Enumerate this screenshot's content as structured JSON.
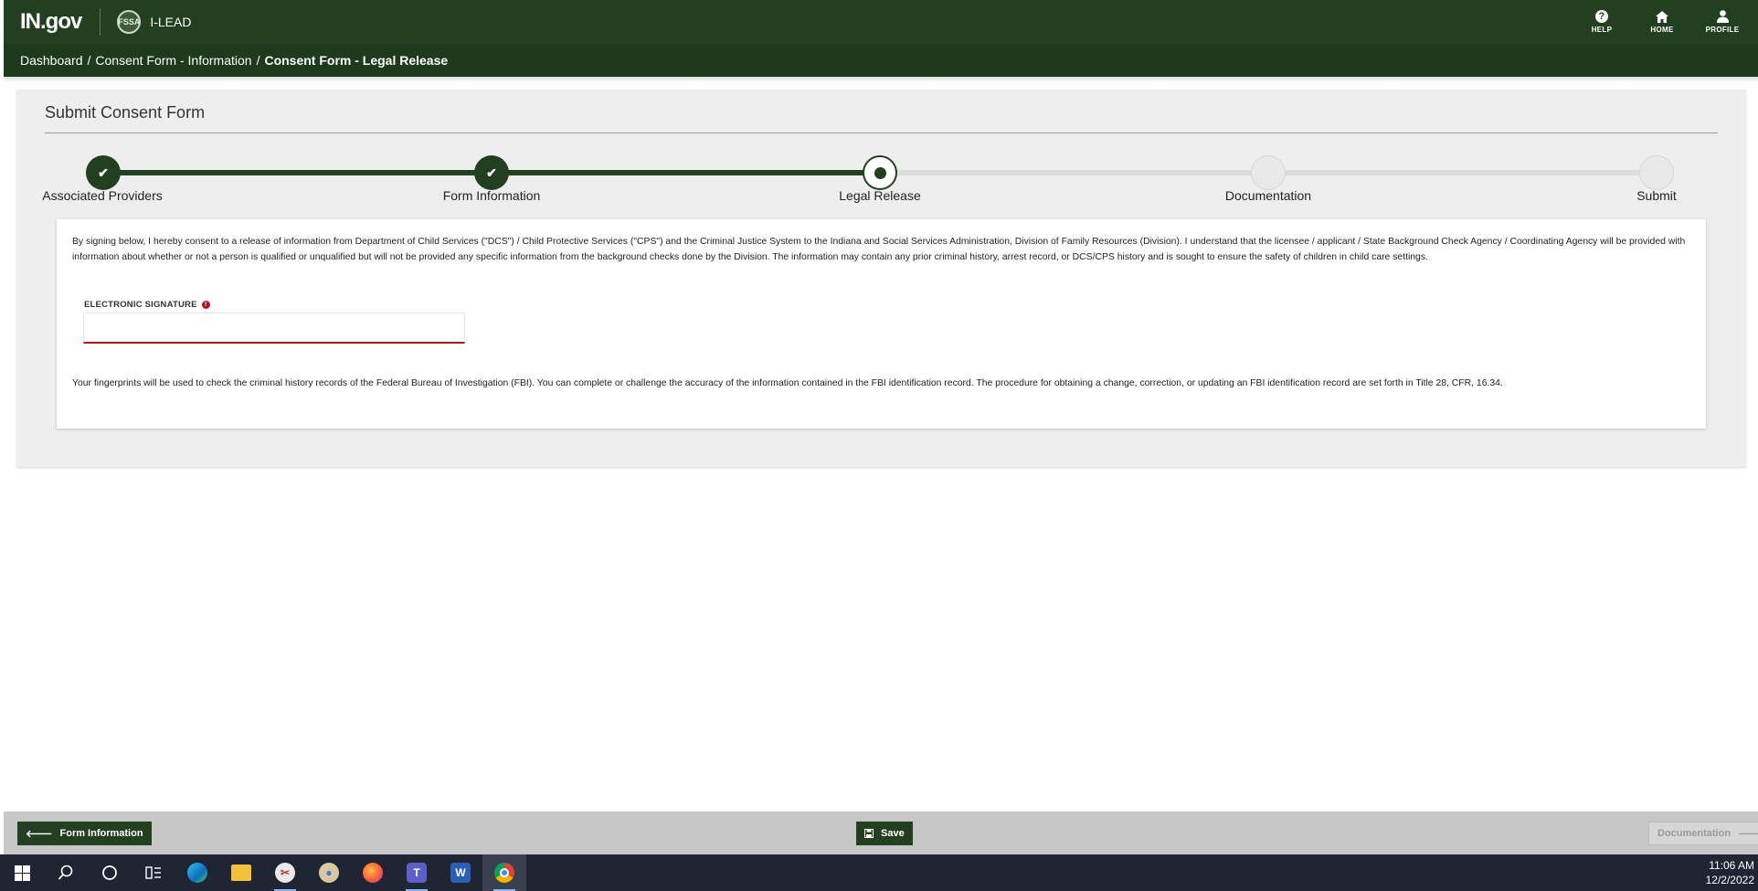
{
  "header": {
    "logo_text": "IN.gov",
    "seal_text": "FSSA",
    "app_name": "I-LEAD",
    "actions": [
      {
        "label": "HELP",
        "icon": "help-icon"
      },
      {
        "label": "HOME",
        "icon": "home-icon"
      },
      {
        "label": "PROFILE",
        "icon": "profile-icon"
      }
    ]
  },
  "breadcrumb": {
    "items": [
      "Dashboard",
      "Consent Form - Information",
      "Consent Form - Legal Release"
    ],
    "separator": "/"
  },
  "panel": {
    "title": "Submit Consent Form"
  },
  "stepper": {
    "steps": [
      {
        "label": "Associated Providers",
        "state": "done"
      },
      {
        "label": "Form Information",
        "state": "done"
      },
      {
        "label": "Legal Release",
        "state": "active"
      },
      {
        "label": "Documentation",
        "state": "todo"
      },
      {
        "label": "Submit",
        "state": "todo"
      }
    ],
    "check_glyph": "✔"
  },
  "content": {
    "consent_text": "By signing below, I hereby consent to a release of information from Department of Child Services (\"DCS\") / Child Protective Services (\"CPS\") and the Criminal Justice System to the Indiana and Social Services Administration, Division of Family Resources (Division). I understand that the licensee / applicant / State Background Check Agency / Coordinating Agency will be provided with information about whether or not a person is qualified or unqualified but will not be provided any specific information from the background checks done by the Division. The information may contain any prior criminal history, arrest record, or DCS/CPS history and is sought to ensure the safety of children in child care settings.",
    "signature_label": "ELECTRONIC SIGNATURE",
    "required_glyph": "!",
    "signature_value": "",
    "fbi_text": "Your fingerprints will be used to check the criminal history records of the Federal Bureau of Investigation (FBI). You can complete or challenge the accuracy of the information contained in the FBI identification record. The procedure for obtaining a change, correction, or updating an FBI identification record are set forth in Title 28, CFR, 16.34."
  },
  "actions": {
    "back_label": "Form Information",
    "save_label": "Save",
    "next_label": "Documentation"
  },
  "taskbar": {
    "time": "11:06 AM",
    "date": "12/2/2022"
  },
  "colors": {
    "brand_green": "#22401f",
    "required_red": "#b0181b"
  }
}
